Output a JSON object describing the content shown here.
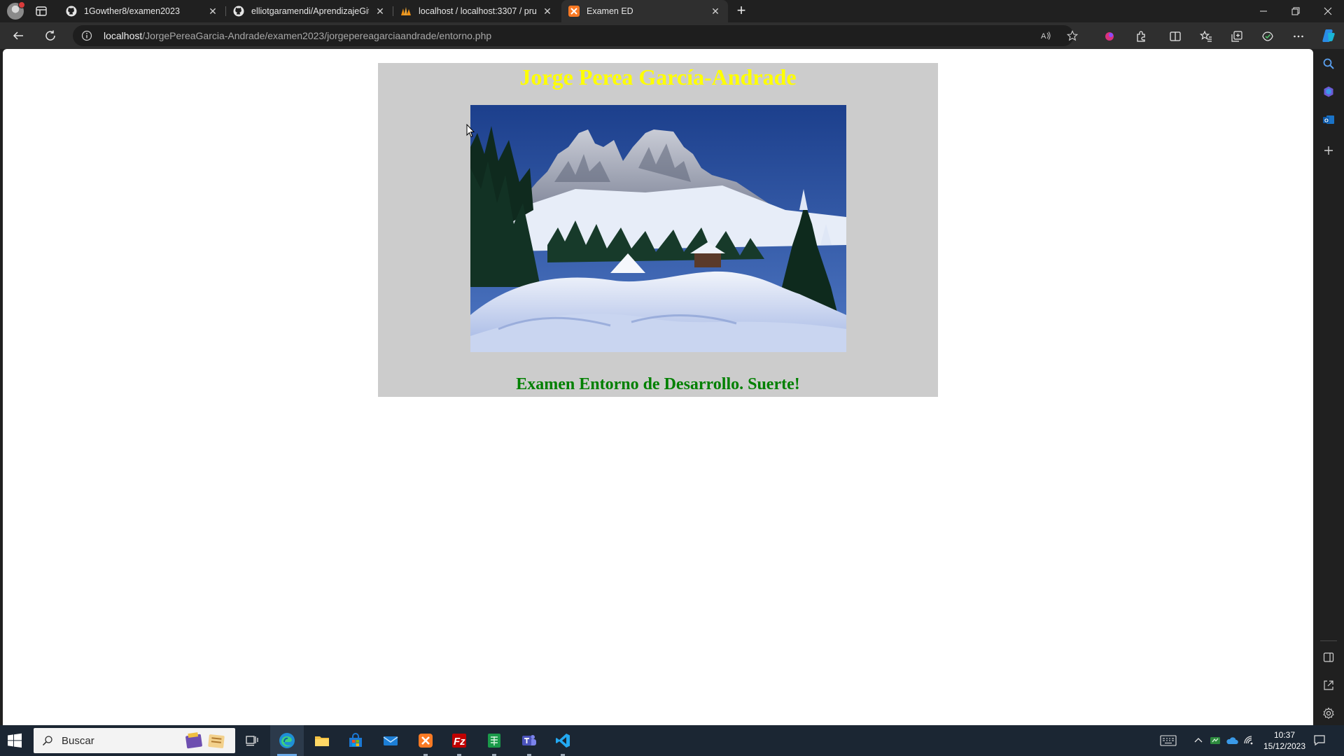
{
  "browser": {
    "tabs": [
      {
        "title": "1Gowther8/examen2023",
        "icon": "github-icon",
        "active": false
      },
      {
        "title": "elliotgaramendi/AprendizajeGit:",
        "icon": "github-icon",
        "active": false
      },
      {
        "title": "localhost / localhost:3307 / prue",
        "icon": "phpmyadmin-icon",
        "active": false
      },
      {
        "title": "Examen ED",
        "icon": "xampp-icon",
        "active": true
      }
    ],
    "address": {
      "host": "localhost",
      "path": "/JorgePereaGarcia-Andrade/examen2023/jorgepereagarciaandrade/entorno.php"
    }
  },
  "page": {
    "heading": "Jorge Perea García-Andrade",
    "heading_color": "#ffff00",
    "image_subject": "snowy mountain landscape with pine trees and a cabin",
    "subheading": "Examen Entorno de Desarrollo. Suerte!",
    "subheading_color": "#008000",
    "container_bg": "#cccccc"
  },
  "taskbar": {
    "search_placeholder": "Buscar",
    "apps": [
      "task-view-icon",
      "edge-icon",
      "file-explorer-icon",
      "store-icon",
      "mail-icon",
      "xampp-icon",
      "filezilla-icon",
      "spreadsheet-icon",
      "teams-icon",
      "vscode-icon"
    ],
    "clock": {
      "time": "10:37",
      "date": "15/12/2023"
    }
  },
  "colors": {
    "accent": "#6aa9e8",
    "chrome_dark": "#202020",
    "chrome_mid": "#2f2f2f"
  }
}
